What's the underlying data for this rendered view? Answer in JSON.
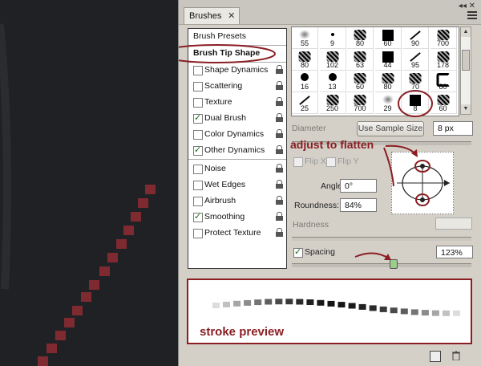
{
  "colors": {
    "accent": "#8b1e23",
    "canvas": "#1f2124",
    "panel": "#d4d0c8"
  },
  "panel": {
    "tab_label": "Brushes",
    "tab_close": "✕",
    "panel_close": "◂◂  ✕"
  },
  "left_list": {
    "presets": "Brush Presets",
    "tip_shape": "Brush Tip Shape",
    "items": [
      {
        "label": "Shape Dynamics",
        "checked": false
      },
      {
        "label": "Scattering",
        "checked": false
      },
      {
        "label": "Texture",
        "checked": false
      },
      {
        "label": "Dual Brush",
        "checked": true
      },
      {
        "label": "Color Dynamics",
        "checked": false
      },
      {
        "label": "Other Dynamics",
        "checked": true
      },
      {
        "label": "Noise",
        "checked": false
      },
      {
        "label": "Wet Edges",
        "checked": false
      },
      {
        "label": "Airbrush",
        "checked": false
      },
      {
        "label": "Smoothing",
        "checked": true
      },
      {
        "label": "Protect Texture",
        "checked": false
      }
    ]
  },
  "brush_grid": {
    "sizes": [
      "55",
      "9",
      "80",
      "60",
      "90",
      "700",
      "80",
      "102",
      "63",
      "44",
      "95",
      "178",
      "16",
      "13",
      "60",
      "80",
      "70",
      "80",
      "25",
      "250",
      "700",
      "29",
      "8",
      "60"
    ]
  },
  "controls": {
    "diameter_label": "Diameter",
    "sample_size_button": "Use Sample Size",
    "diameter_value": "8 px",
    "flip_x": "Flip X",
    "flip_y": "Flip Y",
    "angle_label": "Angle:",
    "angle_value": "0°",
    "roundness_label": "Roundness:",
    "roundness_value": "84%",
    "hardness_label": "Hardness",
    "spacing_label": "Spacing",
    "spacing_value": "123%"
  },
  "annotations": {
    "flatten": "adjust to flatten",
    "preview": "stroke preview"
  }
}
